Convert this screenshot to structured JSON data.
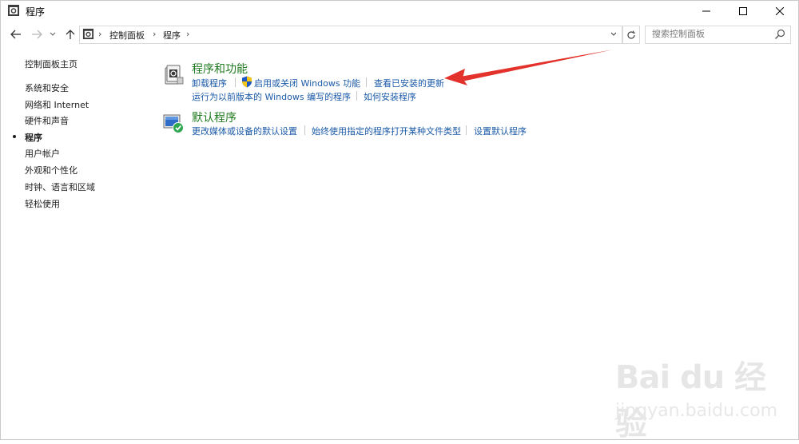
{
  "window": {
    "title": "程序",
    "controls": [
      "minimize-icon",
      "maximize-icon",
      "close-icon"
    ]
  },
  "address_bar": {
    "breadcrumbs": [
      "控制面板",
      "程序"
    ],
    "search_placeholder": "搜索控制面板"
  },
  "sidebar": {
    "home": "控制面板主页",
    "items": [
      {
        "label": "系统和安全",
        "current": false
      },
      {
        "label": "网络和 Internet",
        "current": false
      },
      {
        "label": "硬件和声音",
        "current": false
      },
      {
        "label": "程序",
        "current": true
      },
      {
        "label": "用户帐户",
        "current": false
      },
      {
        "label": "外观和个性化",
        "current": false
      },
      {
        "label": "时钟、语言和区域",
        "current": false
      },
      {
        "label": "轻松使用",
        "current": false
      }
    ]
  },
  "categories": [
    {
      "title": "程序和功能",
      "icon": "programs-features-icon",
      "links": [
        "卸载程序",
        "启用或关闭 Windows 功能",
        "查看已安装的更新",
        "运行为以前版本的 Windows 编写的程序",
        "如何安装程序"
      ]
    },
    {
      "title": "默认程序",
      "icon": "default-programs-icon",
      "links": [
        "更改媒体或设备的默认设置",
        "始终使用指定的程序打开某种文件类型",
        "设置默认程序"
      ]
    }
  ],
  "annotation": {
    "color": "#e3322b"
  },
  "watermark": {
    "logo": "Bai du 经验",
    "url": "jingyan.baidu.com"
  },
  "colors": {
    "link": "#1a5aa8",
    "category_title": "#1e7a1e"
  }
}
